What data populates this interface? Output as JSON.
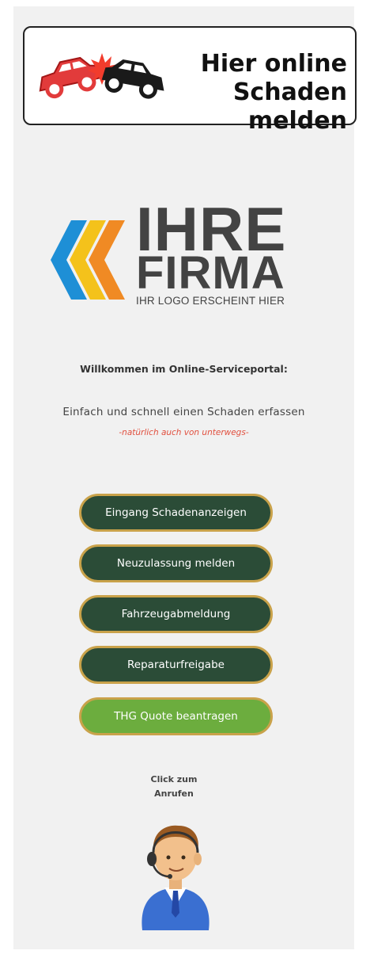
{
  "banner": {
    "line1": "Hier online",
    "line2": "Schaden melden",
    "icon": "car-crash-icon"
  },
  "logo": {
    "word1": "IHRE",
    "word2": "FIRMA",
    "tagline": "IHR LOGO ERSCHEINT HIER",
    "colors": {
      "blue": "#1e8fd6",
      "yellow": "#f4c21b",
      "orange": "#f08a24",
      "text": "#434343"
    }
  },
  "welcome": "Willkommen im Online-Serviceportal:",
  "intro": "Einfach und schnell einen Schaden erfassen",
  "note": "-natürlich auch von unterwegs-",
  "buttons": [
    {
      "label": "Eingang Schadenanzeigen",
      "style": "dark"
    },
    {
      "label": "Neuzulassung melden",
      "style": "dark"
    },
    {
      "label": "Fahrzeugabmeldung",
      "style": "dark"
    },
    {
      "label": "Reparaturfreigabe",
      "style": "dark"
    },
    {
      "label": "THG Quote beantragen",
      "style": "light"
    }
  ],
  "call": {
    "line1": "Click zum",
    "line2": "Anrufen",
    "icon": "call-agent-icon"
  },
  "colors": {
    "button_dark": "#2b4c37",
    "button_light": "#6cad3e",
    "button_border": "#c9a24a",
    "note_red": "#e14f3e"
  }
}
